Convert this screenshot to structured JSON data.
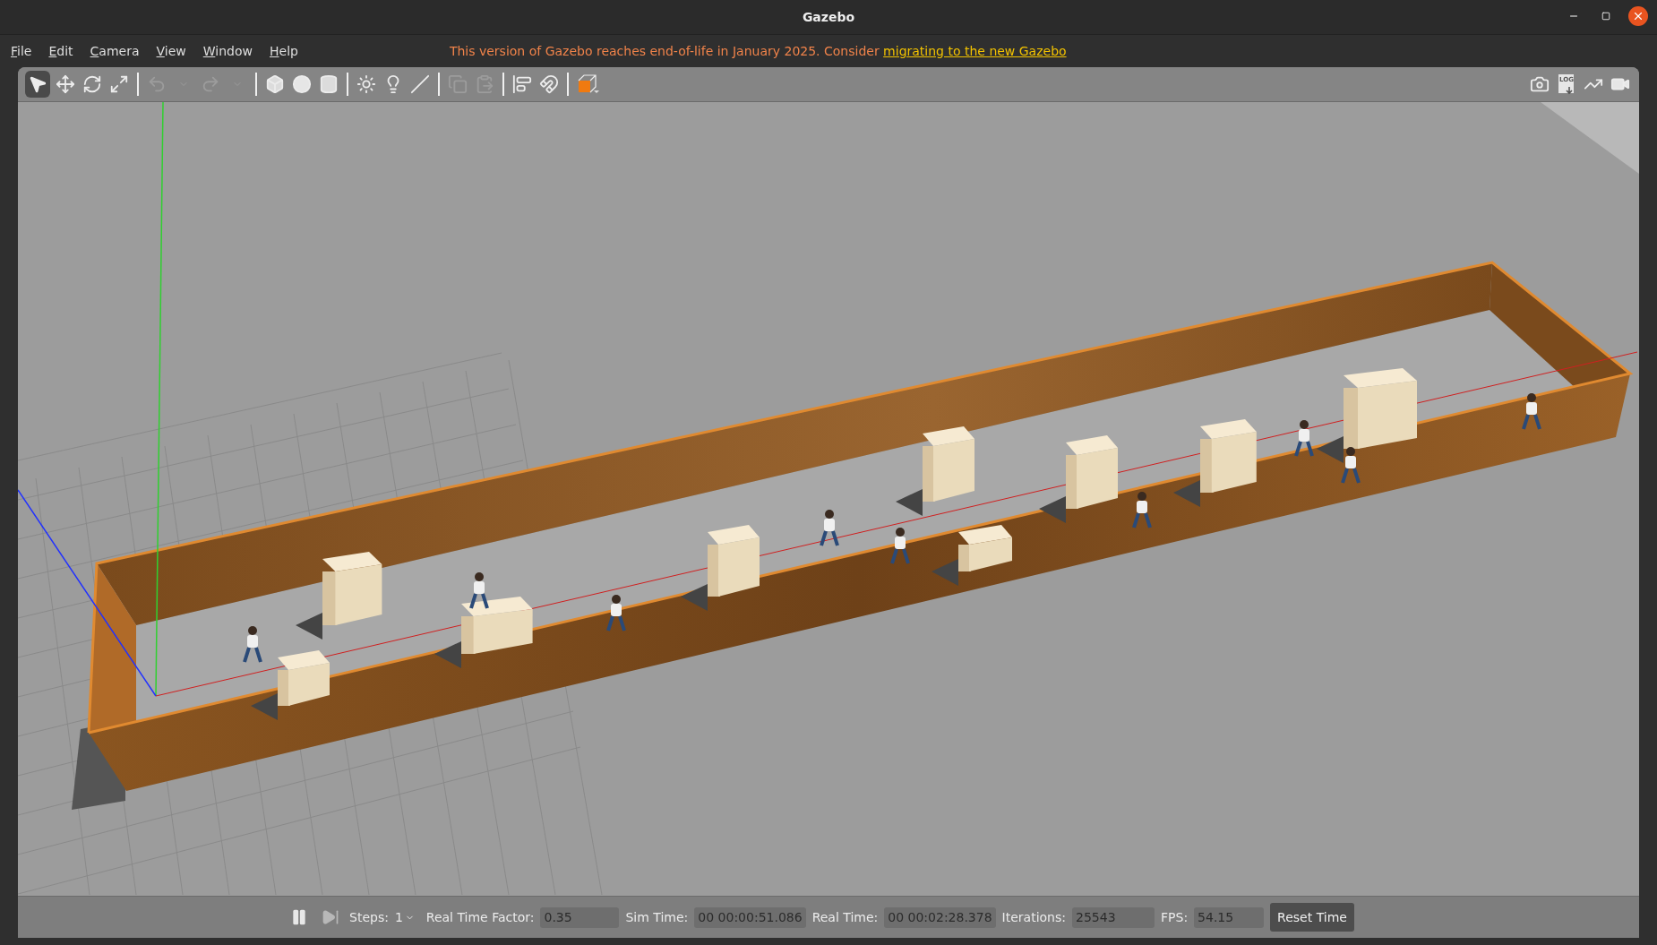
{
  "window": {
    "title": "Gazebo"
  },
  "menu": [
    {
      "label": "File"
    },
    {
      "label": "Edit"
    },
    {
      "label": "Camera"
    },
    {
      "label": "View"
    },
    {
      "label": "Window"
    },
    {
      "label": "Help"
    }
  ],
  "notice": {
    "text": "This version of Gazebo reaches end-of-life in January 2025. Consider",
    "link": "migrating to the new Gazebo"
  },
  "toolbar": {
    "left": [
      {
        "kind": "select",
        "selected": true,
        "disabled": false
      },
      {
        "kind": "translate",
        "selected": false,
        "disabled": false
      },
      {
        "kind": "rotate",
        "selected": false,
        "disabled": false
      },
      {
        "kind": "scale",
        "selected": false,
        "disabled": false
      },
      {
        "kind": "separator"
      },
      {
        "kind": "undo",
        "selected": false,
        "disabled": true
      },
      {
        "kind": "dropdown",
        "selected": false,
        "disabled": true
      },
      {
        "kind": "redo",
        "selected": false,
        "disabled": true
      },
      {
        "kind": "dropdown",
        "selected": false,
        "disabled": true
      },
      {
        "kind": "separator"
      },
      {
        "kind": "box",
        "selected": false,
        "disabled": false
      },
      {
        "kind": "sphere",
        "selected": false,
        "disabled": false
      },
      {
        "kind": "cylinder",
        "selected": false,
        "disabled": false
      },
      {
        "kind": "separator"
      },
      {
        "kind": "point-light",
        "selected": false,
        "disabled": false
      },
      {
        "kind": "spot-light",
        "selected": false,
        "disabled": false
      },
      {
        "kind": "directional-light",
        "selected": false,
        "disabled": false
      },
      {
        "kind": "separator"
      },
      {
        "kind": "copy",
        "selected": false,
        "disabled": true
      },
      {
        "kind": "paste",
        "selected": false,
        "disabled": true
      },
      {
        "kind": "separator"
      },
      {
        "kind": "align",
        "selected": false,
        "disabled": false
      },
      {
        "kind": "snap",
        "selected": false,
        "disabled": false
      },
      {
        "kind": "separator"
      },
      {
        "kind": "view-angle",
        "selected": false
      }
    ],
    "right": [
      {
        "kind": "screenshot"
      },
      {
        "kind": "log",
        "label": "LOG"
      },
      {
        "kind": "plot"
      },
      {
        "kind": "record"
      }
    ]
  },
  "status_bar": {
    "paused": false,
    "steps_label": "Steps:",
    "steps_value": "1",
    "fields": [
      {
        "label": "Real Time Factor:",
        "value": "0.35"
      },
      {
        "label": "Sim Time:",
        "value": "00 00:00:51.086"
      },
      {
        "label": "Real Time:",
        "value": "00 00:02:28.378"
      },
      {
        "label": "Iterations:",
        "value": "25543"
      },
      {
        "label": "FPS:",
        "value": "54.15"
      }
    ],
    "reset_button": "Reset Time"
  }
}
